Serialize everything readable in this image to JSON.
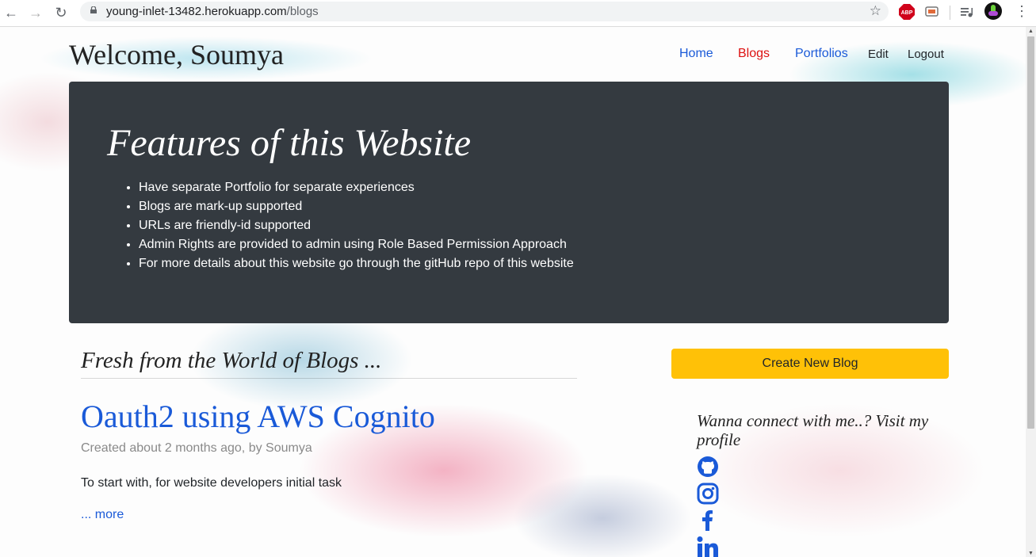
{
  "browser": {
    "url_host": "young-inlet-13482.herokuapp.com",
    "url_path": "/blogs",
    "abp_label": "ABP"
  },
  "header": {
    "welcome": "Welcome, Soumya",
    "nav": {
      "home": "Home",
      "blogs": "Blogs",
      "portfolios": "Portfolios",
      "edit": "Edit",
      "logout": "Logout"
    }
  },
  "jumbotron": {
    "title": "Features of this Website",
    "items": [
      "Have separate Portfolio for separate experiences",
      "Blogs are mark-up supported",
      "URLs are friendly-id supported",
      "Admin Rights are provided to admin using Role Based Permission Approach",
      "For more details about this website go through the gitHub repo of this website"
    ]
  },
  "blogs": {
    "heading": "Fresh from the World of Blogs ...",
    "post": {
      "title": "Oauth2 using AWS Cognito",
      "meta": "Created about 2 months ago, by Soumya",
      "excerpt": "To start with, for website developers initial task",
      "more": "... more"
    }
  },
  "sidebar": {
    "create_button": "Create New Blog",
    "connect_text": "Wanna connect with me..? Visit my profile",
    "social_icons": [
      "github-icon",
      "instagram-icon",
      "facebook-icon",
      "linkedin-icon"
    ]
  },
  "colors": {
    "link_blue": "#1a5ad8",
    "active_red": "#dd1111",
    "jumbotron_bg": "#343a40",
    "create_button_bg": "#ffc107"
  }
}
